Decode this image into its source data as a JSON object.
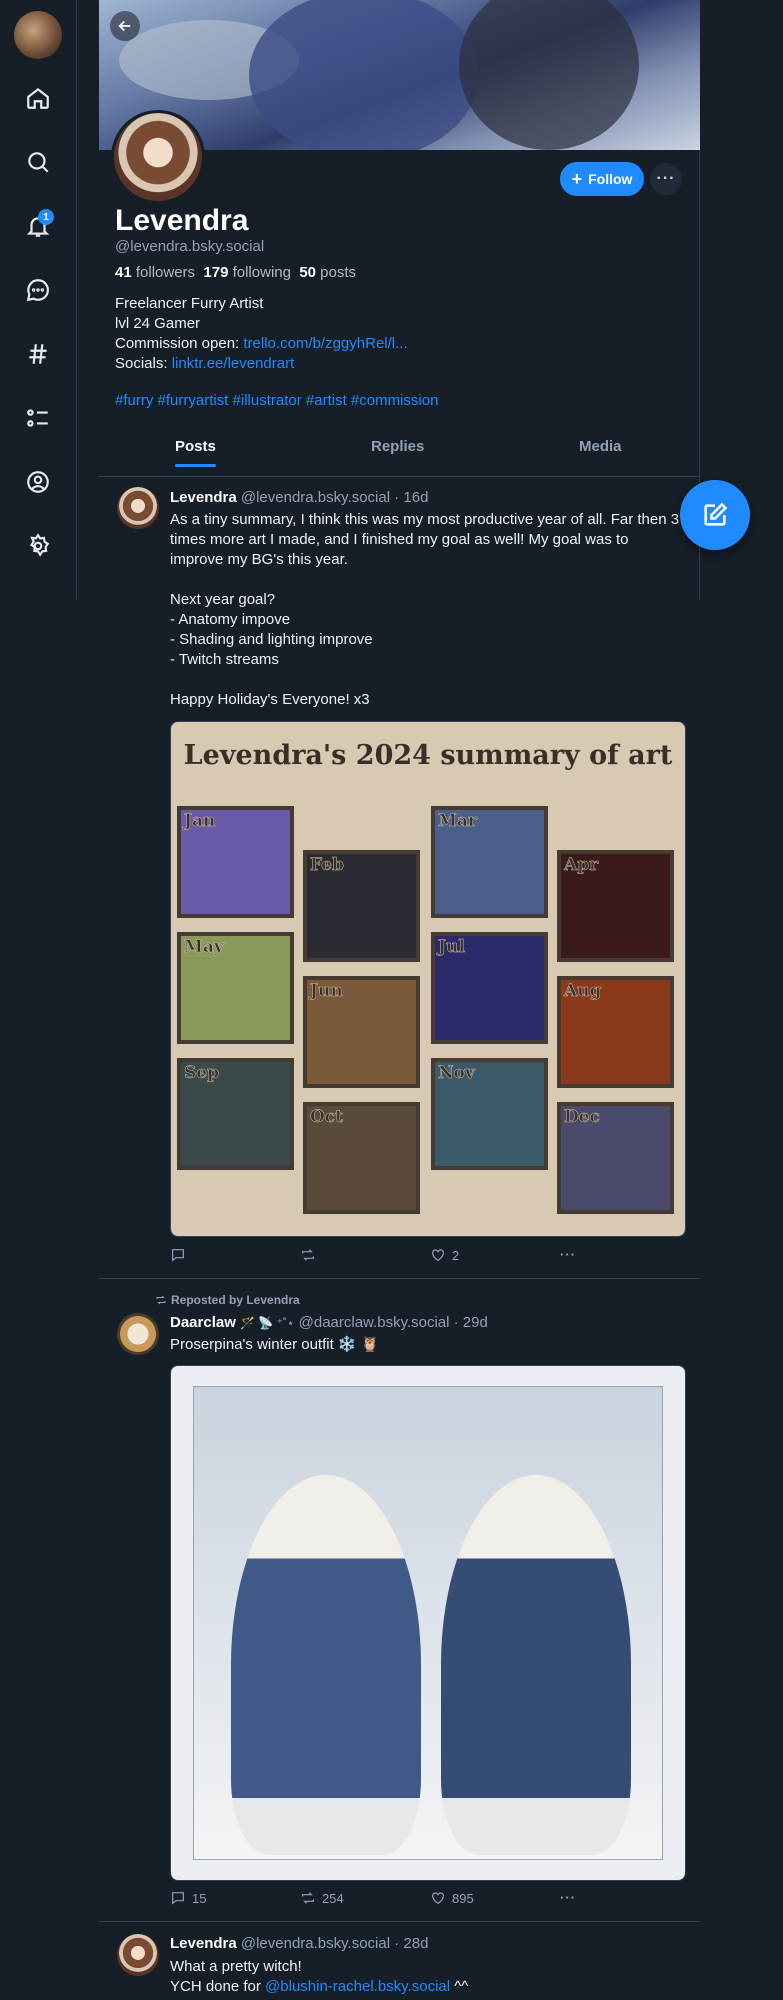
{
  "nav": {
    "items": [
      "home",
      "search",
      "notifications",
      "chat",
      "feeds",
      "lists",
      "profile",
      "settings"
    ],
    "notification_count": "1"
  },
  "profile": {
    "name": "Levendra",
    "handle": "@levendra.bsky.social",
    "followers_count": "41",
    "followers_label": "followers",
    "following_count": "179",
    "following_label": "following",
    "posts_count": "50",
    "posts_label": "posts",
    "follow_label": "Follow",
    "bio_line1": "Freelancer Furry Artist",
    "bio_line2": "lvl 24 Gamer",
    "bio_commission_prefix": "Commission open: ",
    "bio_commission_link": "trello.com/b/zggyhRel/l...",
    "bio_socials_prefix": "Socials: ",
    "bio_socials_link": "linktr.ee/levendrart",
    "tags": "#furry #furryartist #illustrator #artist #commission"
  },
  "tabs": [
    "Posts",
    "Replies",
    "Media"
  ],
  "posts": [
    {
      "author": "Levendra",
      "handle": "@levendra.bsky.social",
      "time": "· 16d",
      "text": "As a tiny summary, I think this was my most productive year of all. Far then 3 times more art I made, and I finished my goal as well! My goal was to improve my BG's this year.\n\nNext year goal?\n- Anatomy impove\n- Shading and lighting improve\n- Twitch streams\n\nHappy Holiday's Everyone! x3",
      "image_title": "Levendra's 2024 summary of art",
      "months": [
        "Jan",
        "Feb",
        "Mar",
        "Apr",
        "May",
        "Jun",
        "Jul",
        "Aug",
        "Sep",
        "Oct",
        "Nov",
        "Dec"
      ],
      "replies": "",
      "reposts": "",
      "likes": "2"
    },
    {
      "repost_label": "Reposted by Levendra",
      "author": "Daarclaw",
      "author_emoji": "🪄 📡 ⁺˚⋆",
      "handle": "@daarclaw.bsky.social",
      "time": "· 29d",
      "text": "Proserpina's winter outfit ❄️ 🦉",
      "replies": "15",
      "reposts": "254",
      "likes": "895"
    },
    {
      "author": "Levendra",
      "handle": "@levendra.bsky.social",
      "time": "· 28d",
      "text_line1": "What a pretty witch!",
      "text_line2_prefix": "YCH done for ",
      "text_line2_link": "@blushin-rachel.bsky.social",
      "text_line2_suffix": " ^^"
    }
  ],
  "colors": {
    "accent": "#208bfe",
    "background": "#161e27",
    "border": "#2e4052",
    "muted": "#8fa3b8"
  }
}
